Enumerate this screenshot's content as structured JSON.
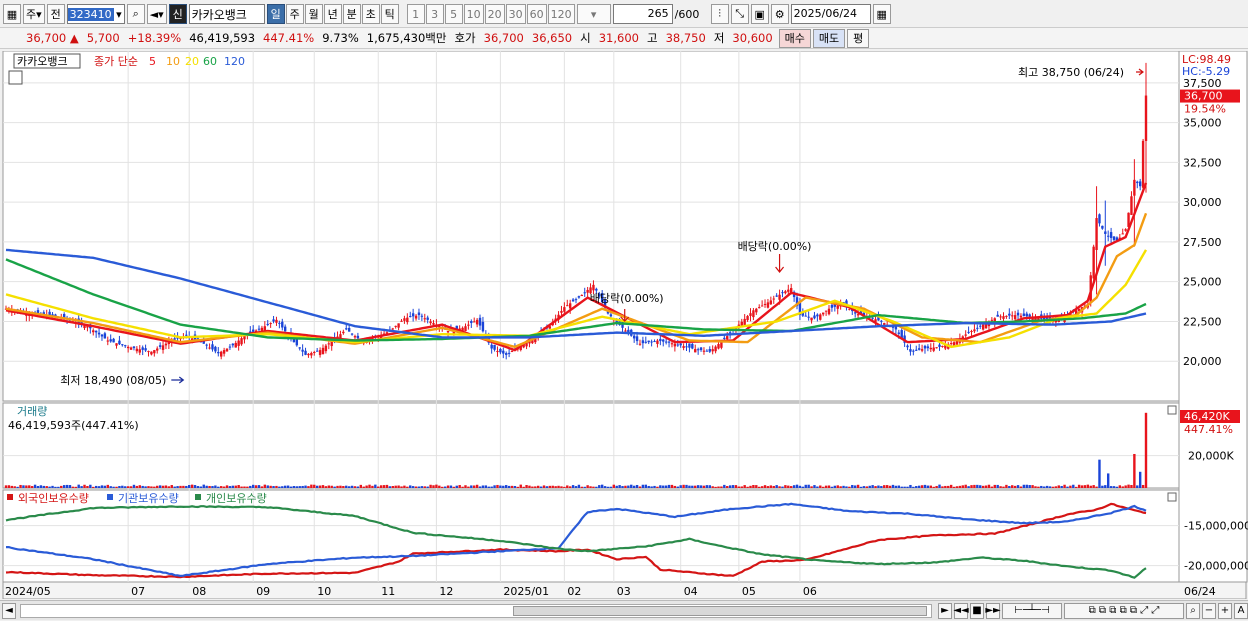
{
  "toolbar": {
    "scope": "주",
    "prev_label": "전",
    "code": "323410",
    "stock_name": "카카오뱅크",
    "badge": "신",
    "periods": [
      "일",
      "주",
      "월",
      "년",
      "분",
      "초",
      "틱"
    ],
    "selected_period": "일",
    "intervals": [
      "1",
      "3",
      "5",
      "10",
      "20",
      "30",
      "60",
      "120"
    ],
    "count": "265",
    "count_total": "/600",
    "date": "2025/06/24"
  },
  "quote": {
    "price": "36,700",
    "change": "5,700",
    "change_pct": "+18.39%",
    "volume": "46,419,593",
    "volume_ratio": "447.41%",
    "turnover": "9.73%",
    "amount": "1,675,430백만",
    "hoga_label": "호가",
    "ask": "36,700",
    "bid": "36,650",
    "open_label": "시",
    "open": "31,600",
    "high_label": "고",
    "high": "38,750",
    "low_label": "저",
    "low": "30,600",
    "buy_label": "매수",
    "sell_label": "매도",
    "eval_label": "평"
  },
  "chart_data": [
    {
      "type": "candlestick",
      "name": "카카오뱅크",
      "legend": {
        "prefix": "종가 단순",
        "periods": [
          "5",
          "10",
          "20",
          "60",
          "120"
        ],
        "colors": [
          "#e8141c",
          "#f39c12",
          "#f5e000",
          "#19a347",
          "#2a5bd7"
        ]
      },
      "ylim": [
        17500,
        39500
      ],
      "yticks": [
        "20,000",
        "22,500",
        "25,000",
        "27,500",
        "30,000",
        "32,500",
        "35,000",
        "37,500"
      ],
      "price_label": "36,700",
      "pct_label": "19.54%",
      "lc": "LC:98.49",
      "hc": "HC:-5.29",
      "annotations": {
        "high": "최고 38,750 (06/24)",
        "low": "최저 18,490 (08/05)",
        "dividend1": "배당락(0.00%)",
        "dividend2": "배당락(0.00%)"
      },
      "x_labels": [
        "2024/05",
        "07",
        "08",
        "09",
        "10",
        "11",
        "12",
        "2025/01",
        "02",
        "03",
        "04",
        "05",
        "06",
        "06/24"
      ],
      "close_path": [
        [
          0,
          23300
        ],
        [
          8,
          23000
        ],
        [
          15,
          22900
        ],
        [
          20,
          22700
        ],
        [
          28,
          22200
        ],
        [
          35,
          21300
        ],
        [
          42,
          20900
        ],
        [
          50,
          20600
        ],
        [
          57,
          21300
        ],
        [
          62,
          21600
        ],
        [
          68,
          21100
        ],
        [
          73,
          20500
        ],
        [
          78,
          21000
        ],
        [
          82,
          21600
        ],
        [
          88,
          22100
        ],
        [
          93,
          22600
        ],
        [
          98,
          21400
        ],
        [
          103,
          20400
        ],
        [
          108,
          20700
        ],
        [
          113,
          21400
        ],
        [
          117,
          22000
        ],
        [
          122,
          21300
        ],
        [
          127,
          21500
        ],
        [
          132,
          21900
        ],
        [
          137,
          22700
        ],
        [
          142,
          22900
        ],
        [
          147,
          22400
        ],
        [
          152,
          21900
        ],
        [
          157,
          22100
        ],
        [
          162,
          22600
        ],
        [
          167,
          20800
        ],
        [
          172,
          20400
        ],
        [
          177,
          21000
        ],
        [
          182,
          21500
        ],
        [
          187,
          22200
        ],
        [
          192,
          23400
        ],
        [
          197,
          24000
        ],
        [
          202,
          24800
        ],
        [
          207,
          23000
        ],
        [
          212,
          22100
        ],
        [
          218,
          21100
        ],
        [
          224,
          21300
        ],
        [
          230,
          21100
        ],
        [
          236,
          20800
        ],
        [
          242,
          20600
        ],
        [
          247,
          21400
        ],
        [
          252,
          22300
        ],
        [
          257,
          23200
        ],
        [
          262,
          23700
        ],
        [
          267,
          24300
        ],
        [
          270,
          24600
        ],
        [
          273,
          22900
        ],
        [
          278,
          22700
        ],
        [
          283,
          23300
        ],
        [
          288,
          23600
        ],
        [
          292,
          23000
        ],
        [
          297,
          22800
        ],
        [
          302,
          22400
        ],
        [
          306,
          22000
        ],
        [
          311,
          20600
        ],
        [
          316,
          20800
        ],
        [
          321,
          20900
        ],
        [
          326,
          21200
        ],
        [
          331,
          21800
        ],
        [
          336,
          22300
        ],
        [
          341,
          22800
        ],
        [
          347,
          22900
        ],
        [
          352,
          22800
        ],
        [
          358,
          22600
        ],
        [
          363,
          22700
        ],
        [
          368,
          23200
        ],
        [
          372,
          23600
        ],
        [
          375,
          29000
        ],
        [
          378,
          28000
        ],
        [
          382,
          27500
        ],
        [
          385,
          28300
        ],
        [
          388,
          31400
        ],
        [
          390,
          31000
        ],
        [
          392,
          36700
        ]
      ],
      "ma": {
        "5": [
          [
            0,
            23200
          ],
          [
            30,
            22200
          ],
          [
            60,
            21100
          ],
          [
            90,
            21900
          ],
          [
            120,
            21300
          ],
          [
            150,
            22300
          ],
          [
            175,
            20700
          ],
          [
            200,
            24000
          ],
          [
            230,
            21200
          ],
          [
            250,
            21300
          ],
          [
            270,
            24300
          ],
          [
            290,
            23400
          ],
          [
            310,
            21200
          ],
          [
            330,
            21400
          ],
          [
            350,
            22700
          ],
          [
            365,
            22900
          ],
          [
            372,
            23800
          ],
          [
            378,
            27200
          ],
          [
            385,
            27800
          ],
          [
            392,
            31200
          ]
        ],
        "10": [
          [
            0,
            23300
          ],
          [
            30,
            22400
          ],
          [
            60,
            21200
          ],
          [
            90,
            21800
          ],
          [
            120,
            21100
          ],
          [
            150,
            22100
          ],
          [
            175,
            20900
          ],
          [
            205,
            23300
          ],
          [
            235,
            21300
          ],
          [
            255,
            21200
          ],
          [
            275,
            24000
          ],
          [
            295,
            23300
          ],
          [
            315,
            21500
          ],
          [
            335,
            21200
          ],
          [
            355,
            22500
          ],
          [
            368,
            22900
          ],
          [
            375,
            24000
          ],
          [
            382,
            26600
          ],
          [
            388,
            27300
          ],
          [
            392,
            29300
          ]
        ],
        "20": [
          [
            0,
            24200
          ],
          [
            30,
            22700
          ],
          [
            60,
            21500
          ],
          [
            90,
            21700
          ],
          [
            120,
            21200
          ],
          [
            150,
            21700
          ],
          [
            180,
            21600
          ],
          [
            205,
            22800
          ],
          [
            235,
            21700
          ],
          [
            265,
            22500
          ],
          [
            285,
            23800
          ],
          [
            305,
            22500
          ],
          [
            325,
            20900
          ],
          [
            345,
            21500
          ],
          [
            362,
            22700
          ],
          [
            375,
            23000
          ],
          [
            385,
            24800
          ],
          [
            392,
            27000
          ]
        ],
        "60": [
          [
            0,
            26400
          ],
          [
            30,
            24200
          ],
          [
            60,
            22300
          ],
          [
            90,
            21500
          ],
          [
            120,
            21300
          ],
          [
            150,
            21400
          ],
          [
            180,
            21600
          ],
          [
            210,
            22400
          ],
          [
            240,
            22000
          ],
          [
            270,
            21900
          ],
          [
            300,
            22900
          ],
          [
            330,
            22400
          ],
          [
            350,
            22500
          ],
          [
            370,
            22700
          ],
          [
            385,
            23000
          ],
          [
            392,
            23600
          ]
        ],
        "120": [
          [
            0,
            27000
          ],
          [
            30,
            26500
          ],
          [
            60,
            25200
          ],
          [
            90,
            23700
          ],
          [
            120,
            22200
          ],
          [
            150,
            21500
          ],
          [
            180,
            21500
          ],
          [
            210,
            21800
          ],
          [
            240,
            21600
          ],
          [
            270,
            21900
          ],
          [
            300,
            22200
          ],
          [
            330,
            22400
          ],
          [
            360,
            22300
          ],
          [
            380,
            22500
          ],
          [
            392,
            23000
          ]
        ]
      },
      "spikes": [
        [
          375,
          31000,
          24200
        ],
        [
          378,
          30100,
          26000
        ],
        [
          388,
          32700,
          27200
        ],
        [
          392,
          38750,
          30600
        ]
      ],
      "dividend_index": [
        266,
        210
      ]
    },
    {
      "type": "bar",
      "name": "거래량",
      "subtitle": "46,419,593주(447.41%)",
      "last_label": "46,420K",
      "last_pct": "447.41%",
      "ytick": "20,000K",
      "ylim": [
        0,
        50000
      ],
      "spikes": [
        [
          376,
          17500
        ],
        [
          379,
          9000
        ],
        [
          388,
          21000
        ],
        [
          390,
          10000
        ],
        [
          392,
          46420
        ]
      ],
      "base": 1400
    },
    {
      "type": "line",
      "title_items": [
        "외국인보유수량",
        "기관보유수량",
        "개인보유수량"
      ],
      "colors": [
        "#d41515",
        "#2a5bd7",
        "#2a8a4a"
      ],
      "ylim": [
        -21800,
        -11800
      ],
      "yticks": [
        "-15,000,000",
        "-20,000,000"
      ],
      "series": {
        "외국인보유수량": [
          [
            0,
            -20800
          ],
          [
            30,
            -21200
          ],
          [
            60,
            -21400
          ],
          [
            90,
            -21000
          ],
          [
            120,
            -20900
          ],
          [
            135,
            -19500
          ],
          [
            140,
            -18500
          ],
          [
            170,
            -18000
          ],
          [
            190,
            -18200
          ],
          [
            200,
            -18000
          ],
          [
            210,
            -19200
          ],
          [
            220,
            -18900
          ],
          [
            225,
            -20500
          ],
          [
            240,
            -21000
          ],
          [
            250,
            -21300
          ],
          [
            260,
            -19500
          ],
          [
            275,
            -19300
          ],
          [
            280,
            -18800
          ],
          [
            300,
            -16800
          ],
          [
            320,
            -16200
          ],
          [
            340,
            -16000
          ],
          [
            355,
            -14600
          ],
          [
            365,
            -13600
          ],
          [
            375,
            -13000
          ],
          [
            380,
            -12300
          ],
          [
            388,
            -13100
          ],
          [
            392,
            -13400
          ]
        ],
        "기관보유수량": [
          [
            0,
            -17700
          ],
          [
            30,
            -19200
          ],
          [
            60,
            -21300
          ],
          [
            90,
            -19800
          ],
          [
            120,
            -19000
          ],
          [
            140,
            -18800
          ],
          [
            170,
            -18200
          ],
          [
            190,
            -17800
          ],
          [
            200,
            -13300
          ],
          [
            210,
            -12900
          ],
          [
            230,
            -13900
          ],
          [
            250,
            -12900
          ],
          [
            270,
            -12300
          ],
          [
            290,
            -13200
          ],
          [
            310,
            -13500
          ],
          [
            330,
            -14200
          ],
          [
            350,
            -14700
          ],
          [
            365,
            -14500
          ],
          [
            380,
            -13400
          ],
          [
            388,
            -12600
          ],
          [
            392,
            -13100
          ]
        ],
        "개인보유수량": [
          [
            0,
            -14300
          ],
          [
            30,
            -12800
          ],
          [
            60,
            -12600
          ],
          [
            90,
            -12700
          ],
          [
            120,
            -13800
          ],
          [
            140,
            -15900
          ],
          [
            170,
            -16900
          ],
          [
            190,
            -17900
          ],
          [
            200,
            -18200
          ],
          [
            220,
            -17600
          ],
          [
            235,
            -16700
          ],
          [
            245,
            -17500
          ],
          [
            260,
            -18600
          ],
          [
            280,
            -19400
          ],
          [
            300,
            -19800
          ],
          [
            320,
            -19600
          ],
          [
            335,
            -19000
          ],
          [
            350,
            -19400
          ],
          [
            365,
            -20100
          ],
          [
            380,
            -20600
          ],
          [
            388,
            -21500
          ],
          [
            392,
            -20300
          ]
        ]
      }
    }
  ]
}
